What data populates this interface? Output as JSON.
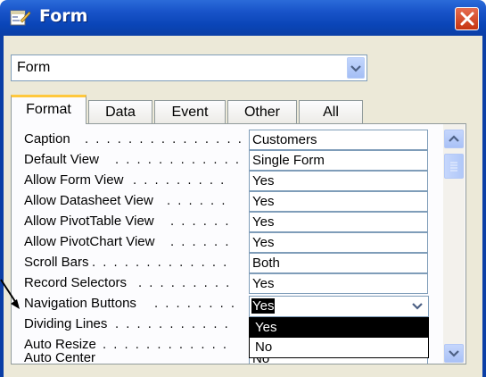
{
  "window": {
    "title": "Form",
    "close_icon": "close-icon",
    "title_icon": "form-properties-icon"
  },
  "object_selector": {
    "value": "Form"
  },
  "tabs": [
    {
      "label": "Format",
      "active": true
    },
    {
      "label": "Data",
      "active": false
    },
    {
      "label": "Event",
      "active": false
    },
    {
      "label": "Other",
      "active": false
    },
    {
      "label": "All",
      "active": false
    }
  ],
  "properties": [
    {
      "label": "Caption",
      "dots": ". . . . . . . . . . . . . . .",
      "value": "Customers"
    },
    {
      "label": "Default View",
      "dots": ". . . . . . . . . . . .",
      "value": "Single Form"
    },
    {
      "label": "Allow Form View",
      "dots": ". . . . . . . . .",
      "value": "Yes"
    },
    {
      "label": "Allow Datasheet View",
      "dots": ". . . . . .",
      "value": "Yes"
    },
    {
      "label": "Allow PivotTable View",
      "dots": ". . . . . .",
      "value": "Yes"
    },
    {
      "label": "Allow PivotChart View",
      "dots": ". . . . . .",
      "value": "Yes"
    },
    {
      "label": "Scroll Bars",
      "dots": ". . . . . . . . . . . . .",
      "value": "Both"
    },
    {
      "label": "Record Selectors",
      "dots": ". . . . . . . . .",
      "value": "Yes"
    },
    {
      "label": "Navigation Buttons",
      "dots": ". . . . . . . .",
      "value": "Yes"
    },
    {
      "label": "Dividing Lines",
      "dots": ". . . . . . . . . . .",
      "value": ""
    },
    {
      "label": "Auto Resize",
      "dots": ". . . . . . . . . . . .",
      "value": ""
    },
    {
      "label": "Auto Center",
      "dots": ". . . . . . . . . . . .",
      "value": "No"
    }
  ],
  "dropdown": {
    "options": [
      "Yes",
      "No"
    ],
    "selected": "Yes"
  },
  "colors": {
    "titlebar": "#0b3fa6",
    "panel": "#fcfcfe",
    "tab_accent": "#ffc83c",
    "selection": "#000000"
  }
}
